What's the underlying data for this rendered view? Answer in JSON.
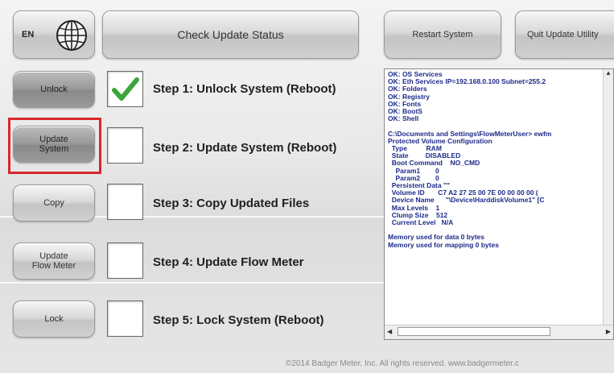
{
  "header": {
    "language": "EN",
    "check_update_label": "Check Update Status",
    "restart_label": "Restart System",
    "quit_label": "Quit Update Utility"
  },
  "steps": [
    {
      "button": "Unlock",
      "label": "Step 1: Unlock System (Reboot)",
      "checked": true,
      "highlighted": false
    },
    {
      "button": "Update\nSystem",
      "label": "Step 2: Update System (Reboot)",
      "checked": false,
      "highlighted": true
    },
    {
      "button": "Copy",
      "label": "Step 3: Copy Updated Files",
      "checked": false,
      "highlighted": false
    },
    {
      "button": "Update\nFlow Meter",
      "label": "Step 4: Update Flow Meter",
      "checked": false,
      "highlighted": false
    },
    {
      "button": "Lock",
      "label": "Step 5: Lock System (Reboot)",
      "checked": false,
      "highlighted": false
    }
  ],
  "console": {
    "lines": [
      "OK: OS Services",
      "OK: Eth Services IP=192.168.0.100 Subnet=255.2",
      "OK: Folders",
      "OK: Registry",
      "OK: Fonts",
      "OK: BootS",
      "OK: Shell",
      "",
      "C:\\Documents and Settings\\FlowMeterUser> ewfm",
      "Protected Volume Configuration",
      "  Type          RAM",
      "  State         DISABLED",
      "  Boot Command    NO_CMD",
      "    Param1        0",
      "    Param2        0",
      "  Persistent Data \"\"",
      "  Volume ID       C7 A2 27 25 00 7E 00 00 00 00 (",
      "  Device Name      \"\\Device\\HarddiskVolume1\" [C",
      "  Max Levels    1",
      "  Clump Size    512",
      "  Current Level   N/A",
      "",
      "Memory used for data 0 bytes",
      "Memory used for mapping 0 bytes"
    ]
  },
  "footer": "©2014 Badger Meter, Inc. All rights reserved.  www.badgermeter.c",
  "colors": {
    "highlight": "#d9262c",
    "check": "#3aa53a",
    "console_text": "#1d2a8a"
  }
}
